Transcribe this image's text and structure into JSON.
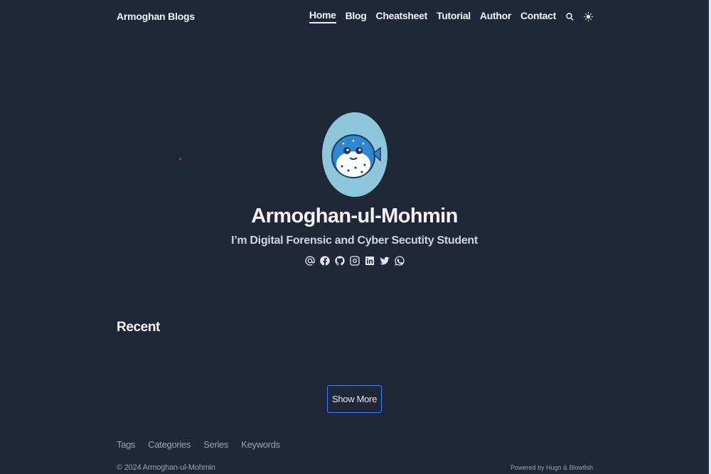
{
  "header": {
    "brand": "Armoghan Blogs",
    "nav": [
      "Home",
      "Blog",
      "Cheatsheet",
      "Tutorial",
      "Author",
      "Contact"
    ],
    "active_nav": "Home",
    "icons": [
      "search-icon",
      "theme-toggle-icon"
    ]
  },
  "hero": {
    "avatar_icon": "pufferfish-avatar",
    "name": "Armoghan-ul-Mohmin",
    "tagline": "I’m Digital Forensic and Cyber Secutity Student",
    "social_icons": [
      "email-icon",
      "facebook-icon",
      "github-icon",
      "instagram-icon",
      "linkedin-icon",
      "twitter-icon",
      "whatsapp-icon"
    ]
  },
  "recent": {
    "title": "Recent",
    "show_more": "Show More"
  },
  "footer": {
    "links": [
      "Tags",
      "Categories",
      "Series",
      "Keywords"
    ],
    "copyright": "© 2024 Armoghan-ul-Mohmin",
    "powered_by": "Powered by Hugo & Blowfish"
  },
  "colors": {
    "background": "#1f2739",
    "text": "#f3f4f6",
    "muted": "#9ca3af",
    "accent_border": "#3b82f6",
    "avatar_bg": "#8ec7dc"
  }
}
